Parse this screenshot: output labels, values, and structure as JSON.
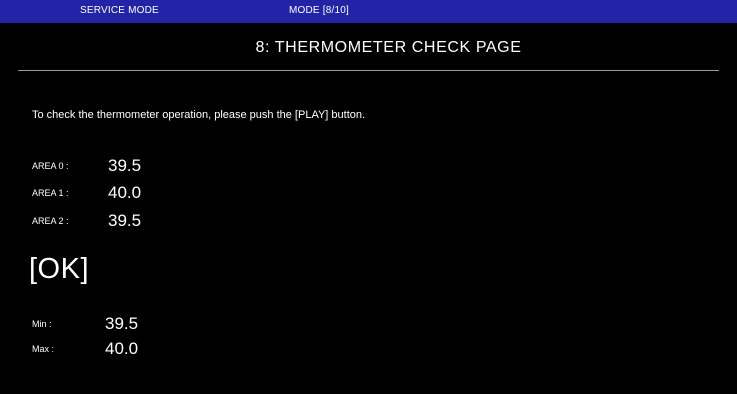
{
  "topbar": {
    "mode_label": "SERVICE MODE",
    "mode_page": "MODE [8/10]",
    "background_color": "#2323a8"
  },
  "page": {
    "title": "8: THERMOMETER CHECK PAGE",
    "instruction": "To check the thermometer operation, please push the [PLAY] button."
  },
  "areas": [
    {
      "label": "AREA 0 :",
      "value": "39.5"
    },
    {
      "label": "AREA 1 :",
      "value": "40.0"
    },
    {
      "label": "AREA 2 :",
      "value": "39.5"
    }
  ],
  "status": "[OK]",
  "summary": {
    "min_label": "Min :",
    "min_value": "39.5",
    "max_label": "Max :",
    "max_value": "40.0"
  }
}
